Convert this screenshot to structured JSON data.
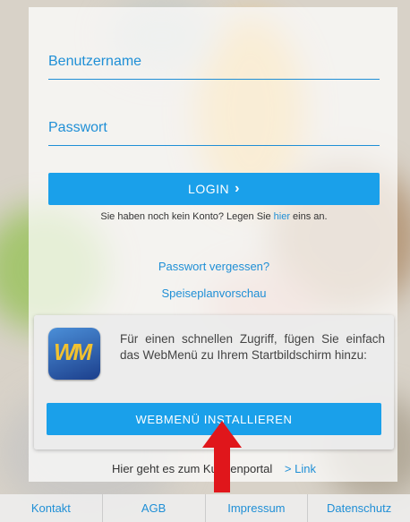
{
  "form": {
    "username_placeholder": "Benutzername",
    "password_placeholder": "Passwort",
    "login_label": "LOGIN",
    "login_chevron": "›",
    "register_text": "Sie haben noch kein Konto? Legen Sie ",
    "register_link": "hier",
    "register_suffix": " eins an."
  },
  "links": {
    "forgot_password": "Passwort vergessen?",
    "menu_preview": "Speiseplanvorschau"
  },
  "install_banner": {
    "icon_letters": "WM",
    "text": "Für einen schnellen Zugriff, fügen Sie einfach das WebMenü zu Ihrem Startbildschirm hinzu:",
    "button_label": "WEBMENÜ INSTALLIEREN"
  },
  "portal": {
    "text": "Hier geht es zum Kundenportal",
    "link": "> Link"
  },
  "footer": {
    "items": [
      "Kontakt",
      "AGB",
      "Impressum",
      "Datenschutz"
    ]
  },
  "colors": {
    "accent": "#1aa0ea",
    "link": "#1f8fd6",
    "arrow": "#e0161b"
  },
  "icons": {
    "login_chevron": "chevron-right-icon",
    "annotation_arrow": "arrow-up-icon"
  }
}
